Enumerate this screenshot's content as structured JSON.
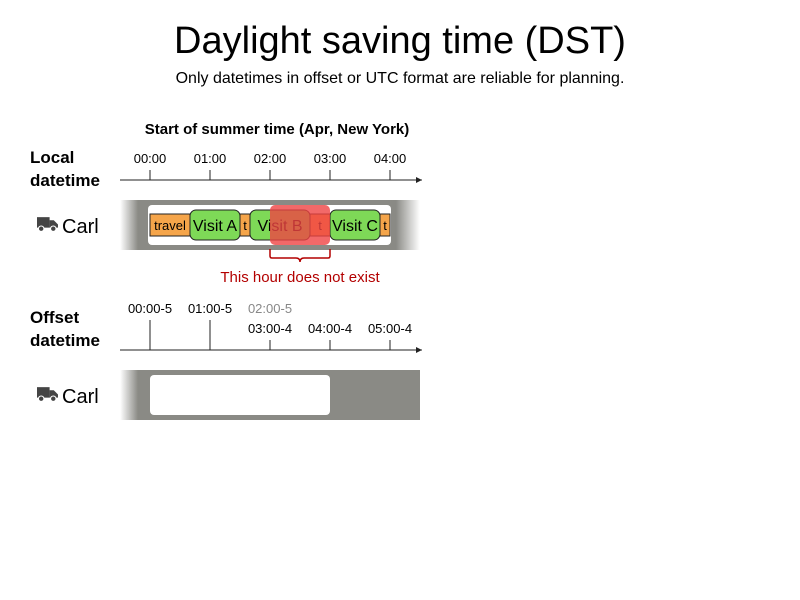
{
  "title": "Daylight saving time (DST)",
  "subtitle": "Only datetimes in offset or UTC format are reliable for planning.",
  "section_heading": "Start of summer time (Apr, New York)",
  "local": {
    "label_line1": "Local",
    "label_line2": "datetime",
    "ticks": [
      "00:00",
      "01:00",
      "02:00",
      "03:00",
      "04:00"
    ]
  },
  "offset": {
    "label_line1": "Offset",
    "label_line2": "datetime",
    "ticks_upper": [
      "00:00-5",
      "01:00-5",
      "02:00-5"
    ],
    "ticks_lower": [
      "03:00-4",
      "04:00-4",
      "05:00-4"
    ]
  },
  "vehicle_name": "Carl",
  "vehicle_icon": "truck-icon",
  "route": {
    "travel_label": "travel",
    "short_travel_label": "t",
    "visits": [
      "Visit A",
      "Visit B",
      "Visit C"
    ]
  },
  "nonexistent_hour_label": "This hour does not exist",
  "colors": {
    "travel": "#f5a54a",
    "visit": "#7ed957",
    "invalid": "#ef4444",
    "invalid_text": "#b30000",
    "lane_gray": "#8a8a85",
    "greyed_tick": "#888888"
  }
}
